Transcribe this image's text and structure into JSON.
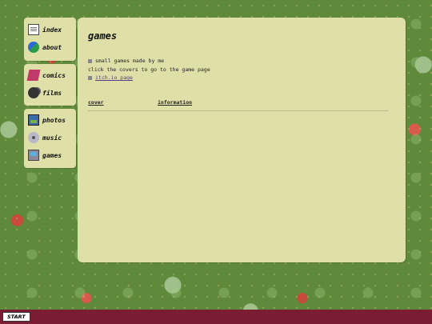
{
  "nav_groups": [
    {
      "items": [
        {
          "label": "index",
          "icon": "document-icon"
        },
        {
          "label": "about",
          "icon": "globe-icon"
        }
      ]
    },
    {
      "items": [
        {
          "label": "comics",
          "icon": "book-icon"
        },
        {
          "label": "films",
          "icon": "film-camera-icon"
        }
      ]
    },
    {
      "items": [
        {
          "label": "photos",
          "icon": "picture-icon"
        },
        {
          "label": "music",
          "icon": "cd-icon"
        },
        {
          "label": "games",
          "icon": "computer-icon"
        }
      ]
    }
  ],
  "page": {
    "title": "games",
    "lines": [
      "small games made by me",
      "click the covers to go to the game page"
    ],
    "link": "itch.io page",
    "table_headers": [
      "cover",
      "information"
    ]
  },
  "taskbar": {
    "start_label": "START",
    "color": "#7a1d33"
  },
  "colors": {
    "panel": "#dfe0a8",
    "background": "#5f8a3c"
  }
}
